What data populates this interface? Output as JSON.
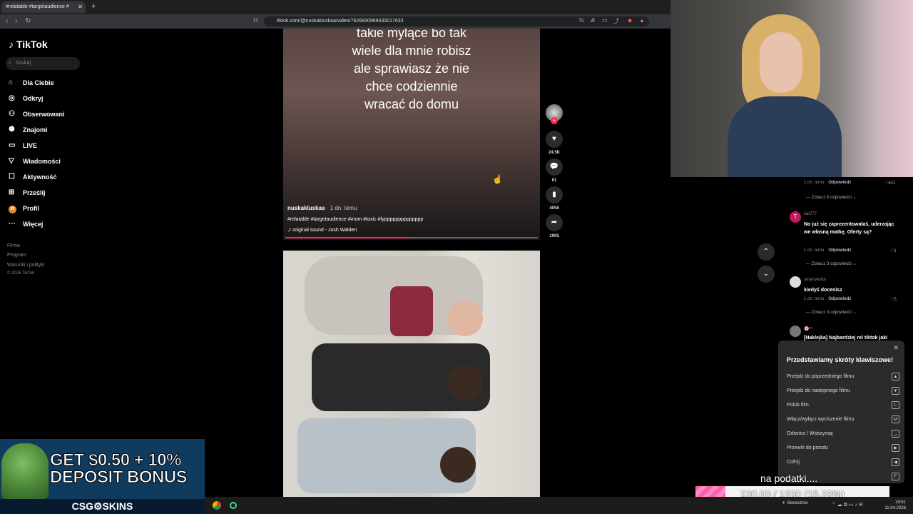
{
  "browser": {
    "tab_title": "#relatable #targetaudience #",
    "url": "tiktok.com/@nuskakluskaa/video/7626830969433017633"
  },
  "sidebar": {
    "logo": "TikTok",
    "search_placeholder": "Szukaj",
    "items": [
      {
        "label": "Dla Ciebie",
        "icon": "home-icon"
      },
      {
        "label": "Odkryj",
        "icon": "compass-icon"
      },
      {
        "label": "Obserwowani",
        "icon": "user-follow-icon"
      },
      {
        "label": "Znajomi",
        "icon": "friends-icon"
      },
      {
        "label": "LIVE",
        "icon": "live-icon"
      },
      {
        "label": "Wiadomości",
        "icon": "messages-icon"
      },
      {
        "label": "Aktywność",
        "icon": "activity-icon"
      },
      {
        "label": "Prześlij",
        "icon": "upload-icon"
      },
      {
        "label": "Profil",
        "icon": "profile-avatar"
      },
      {
        "label": "Więcej",
        "icon": "more-icon"
      }
    ],
    "footer": [
      "Firma",
      "Program",
      "Warunki i polityki",
      "© 2026 TikTok"
    ]
  },
  "video": {
    "caption_lines": [
      "takie mylące bo tak",
      "wiele dla mnie robisz",
      "ale sprawiasz że nie",
      "chce codziennie",
      "wracać do domu"
    ],
    "author": "nuskakluskaa",
    "time": " · 1 dn. temu",
    "hashtags": "#relatable #targetaudience #mom #toxic #fypppppppppppppp",
    "sound": "original sound - Josh Walden",
    "progress": 0.5,
    "likes": "24.5K",
    "comments": "61",
    "saves": "4058",
    "shares": "1905"
  },
  "comments": [
    {
      "meta": "1 dn. temu",
      "reply": "Odpowiedz",
      "likes": "621",
      "view_replies": "Zobacz 6 odpowiedzi"
    },
    {
      "user": "kat777",
      "text": "No już się zaprezentowałaś, uderzając we własną matkę. Oferty są?",
      "meta": "1 dn. temu",
      "reply": "Odpowiedz",
      "likes": "1",
      "view_replies": "Zobacz 3 odpowiedzi"
    },
    {
      "user": "smartvestor",
      "text": "kiedyś docenisz",
      "meta": "1 dn. temu",
      "reply": "Odpowiedz",
      "likes": "5",
      "view_replies": "Zobacz 3 odpowiedzi"
    },
    {
      "user": "🌸ᵃˢ",
      "text": "[Naklejka] Najbardziej rel tiktok jaki"
    }
  ],
  "shortcuts": {
    "title": "Przedstawiamy skróty klawiszowe!",
    "items": [
      {
        "label": "Przejdź do poprzedniego filmu",
        "key": "▲"
      },
      {
        "label": "Przejdź do następnego filmu",
        "key": "▼"
      },
      {
        "label": "Polub film",
        "key": "L"
      },
      {
        "label": "Włącz/wyłącz wyciszenie filmu",
        "key": "M"
      },
      {
        "label": "Odtwórz / Wstrzymaj",
        "key": "␣"
      },
      {
        "label": "Przewiń do przodu",
        "key": "▶"
      },
      {
        "label": "Cofnij",
        "key": "◀"
      },
      {
        "label": "",
        "key": "F"
      }
    ]
  },
  "overlay": {
    "podatki": "na podatki....",
    "goal_text": "230.00 / 1500 (15.33%)",
    "goal_progress": 0.1533
  },
  "ad": {
    "line1": "GET $0.50 + 10%",
    "line2": "DEPOSIT BONUS",
    "brand": "CSG⚙SKINS"
  },
  "taskbar": {
    "weather": "Słonecznie",
    "time": "18:51",
    "date": "11.04.2026"
  }
}
